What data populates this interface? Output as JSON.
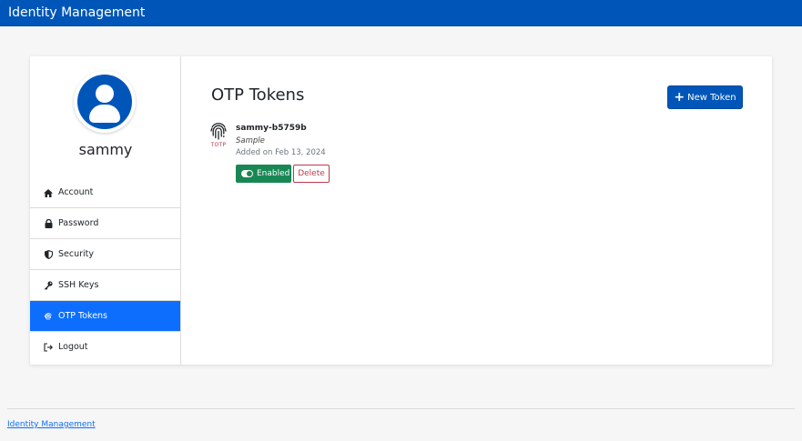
{
  "app": {
    "title": "Identity Management"
  },
  "user": {
    "name": "sammy"
  },
  "sidebar": {
    "items": [
      {
        "label": "Account",
        "icon": "home-icon",
        "active": false
      },
      {
        "label": "Password",
        "icon": "lock-icon",
        "active": false
      },
      {
        "label": "Security",
        "icon": "shield-icon",
        "active": false
      },
      {
        "label": "SSH Keys",
        "icon": "key-icon",
        "active": false
      },
      {
        "label": "OTP Tokens",
        "icon": "fingerprint-icon",
        "active": true
      },
      {
        "label": "Logout",
        "icon": "logout-icon",
        "active": false
      }
    ]
  },
  "main": {
    "title": "OTP Tokens",
    "new_token_label": "New Token",
    "tokens": [
      {
        "name": "sammy-b5759b",
        "type": "TOTP",
        "description": "Sample",
        "added": "Added on Feb 13, 2024",
        "enabled_label": "Enabled",
        "delete_label": "Delete"
      }
    ]
  },
  "footer": {
    "link": "Identity Management"
  },
  "colors": {
    "brand": "#0056b8",
    "active_nav": "#0d6efd",
    "success": "#198754",
    "danger": "#c0394b"
  }
}
